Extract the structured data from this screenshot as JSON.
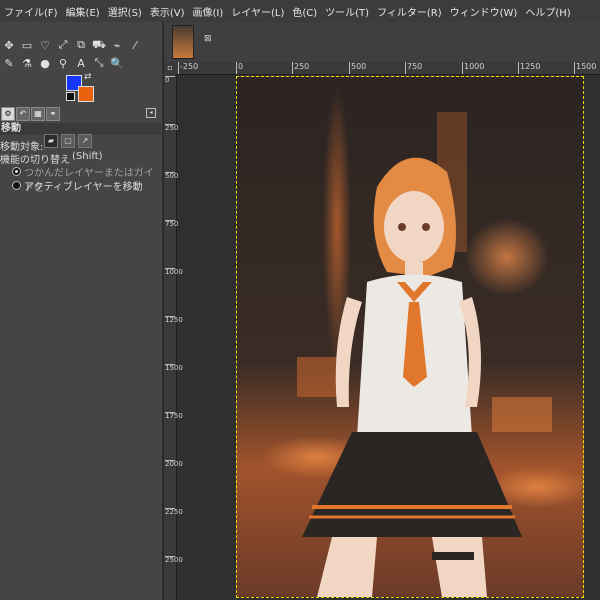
{
  "menubar": {
    "items": [
      "ファイル(F)",
      "編集(E)",
      "選択(S)",
      "表示(V)",
      "画像(I)",
      "レイヤー(L)",
      "色(C)",
      "ツール(T)",
      "フィルター(R)",
      "ウィンドウ(W)",
      "ヘルプ(H)"
    ]
  },
  "tools": {
    "row1": [
      "✥",
      "▭",
      "♡",
      "⤢",
      "⧉",
      "⛟",
      "⌁",
      "⁄"
    ],
    "row2": [
      "✎",
      "⚗",
      "●",
      "⚲",
      "A",
      "⤡",
      "🔍"
    ]
  },
  "colors": {
    "foreground": "#1436ff",
    "background": "#e9630e"
  },
  "tool_options": {
    "title": "移動",
    "move_target_label": "移動対象:",
    "switch_label": "機能の切り替え",
    "switch_hint": "(Shift)",
    "options": [
      {
        "label": "つかんだレイヤーまたはガイドを",
        "selected": true
      },
      {
        "label": "アクティブレイヤーを移動",
        "selected": false
      }
    ]
  },
  "ruler": {
    "h_ticks": [
      "-250",
      "0",
      "250",
      "500",
      "750",
      "1000",
      "1250",
      "1500"
    ],
    "v_ticks": [
      "0",
      "250",
      "500",
      "750",
      "1000",
      "1250",
      "1500",
      "1750",
      "2000",
      "2250",
      "2500"
    ]
  }
}
